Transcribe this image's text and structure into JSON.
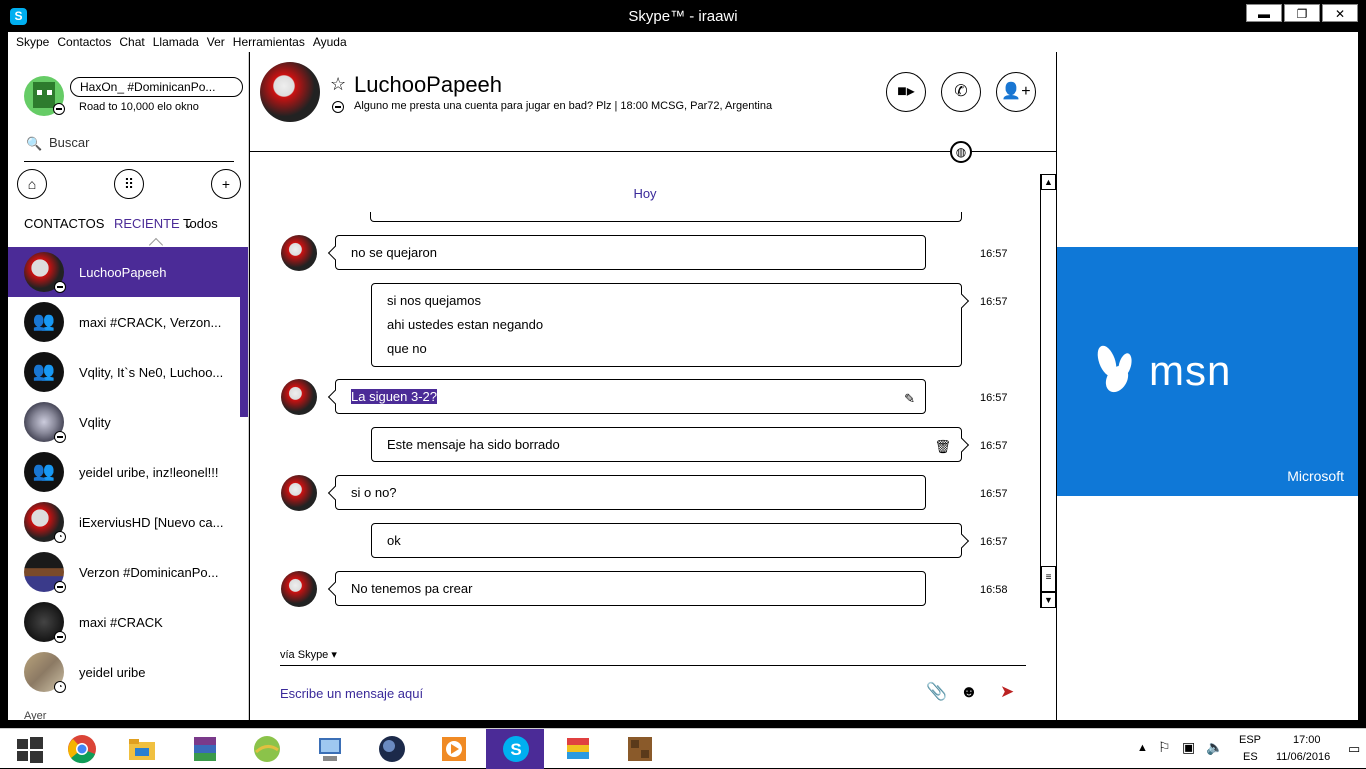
{
  "window": {
    "title": "Skype™ - iraawi",
    "app_icon": "S",
    "buttons": [
      "▬",
      "❐",
      "✕"
    ]
  },
  "menu": [
    "Skype",
    "Contactos",
    "Chat",
    "Llamada",
    "Ver",
    "Herramientas",
    "Ayuda"
  ],
  "me": {
    "mood": "HaxOn_ #DominicanPo...",
    "sub": "Road to 10,000 elo okno"
  },
  "search": {
    "placeholder": "Buscar"
  },
  "tabs": {
    "contacts": "CONTACTOS",
    "recent": "RECIENTE",
    "filter": "Todos"
  },
  "contacts": [
    {
      "name": "LuchooPapeeh",
      "type": "red",
      "status": "away",
      "selected": true
    },
    {
      "name": "maxi #CRACK, Verzon...",
      "type": "group"
    },
    {
      "name": "Vqlity, It`s Ne0, Luchoo...",
      "type": "group"
    },
    {
      "name": "Vqlity",
      "type": "grey",
      "status": "away"
    },
    {
      "name": "yeidel uribe, inz!leonel!!!",
      "type": "group"
    },
    {
      "name": "iExerviusHD [Nuevo ca...",
      "type": "red",
      "status": "clock"
    },
    {
      "name": "Verzon #DominicanPo...",
      "type": "pix",
      "status": "away"
    },
    {
      "name": "maxi #CRACK",
      "type": "dark",
      "status": "away"
    },
    {
      "name": "yeidel uribe",
      "type": "photo",
      "status": "clock"
    }
  ],
  "ayer": "Ayer",
  "header": {
    "name": "LuchooPapeeh",
    "mood": "Alguno me presta una cuenta para jugar en bad? Plz  |  18:00 MCSG, Par72, Argentina"
  },
  "today": "Hoy",
  "messages": [
    {
      "dir": "in",
      "lines": [
        "no se quejaron"
      ],
      "time": "16:57"
    },
    {
      "dir": "out",
      "lines": [
        "si nos quejamos",
        "ahi ustedes estan negando",
        "que no"
      ],
      "time": "16:57"
    },
    {
      "dir": "in",
      "lines": [
        "La siguen 3-2?"
      ],
      "time": "16:57",
      "highlight": true,
      "icon": "edit-icon"
    },
    {
      "dir": "out",
      "lines": [
        "Este mensaje ha sido borrado"
      ],
      "time": "16:57",
      "icon": "trash-icon"
    },
    {
      "dir": "in",
      "lines": [
        "si o no?"
      ],
      "time": "16:57"
    },
    {
      "dir": "out",
      "lines": [
        "ok"
      ],
      "time": "16:57"
    },
    {
      "dir": "in",
      "lines": [
        "No tenemos pa crear"
      ],
      "time": "16:58"
    }
  ],
  "compose": {
    "via": "vía Skype",
    "placeholder": "Escribe un mensaje aquí"
  },
  "ad": {
    "brand": "msn",
    "company": "Microsoft",
    "color": "#0f78d7"
  },
  "tray": {
    "lang1": "ESP",
    "lang2": "ES",
    "time": "17:00",
    "date": "11/06/2016"
  },
  "colors": {
    "accent": "#4b2b97",
    "link": "#3a2a9a"
  }
}
